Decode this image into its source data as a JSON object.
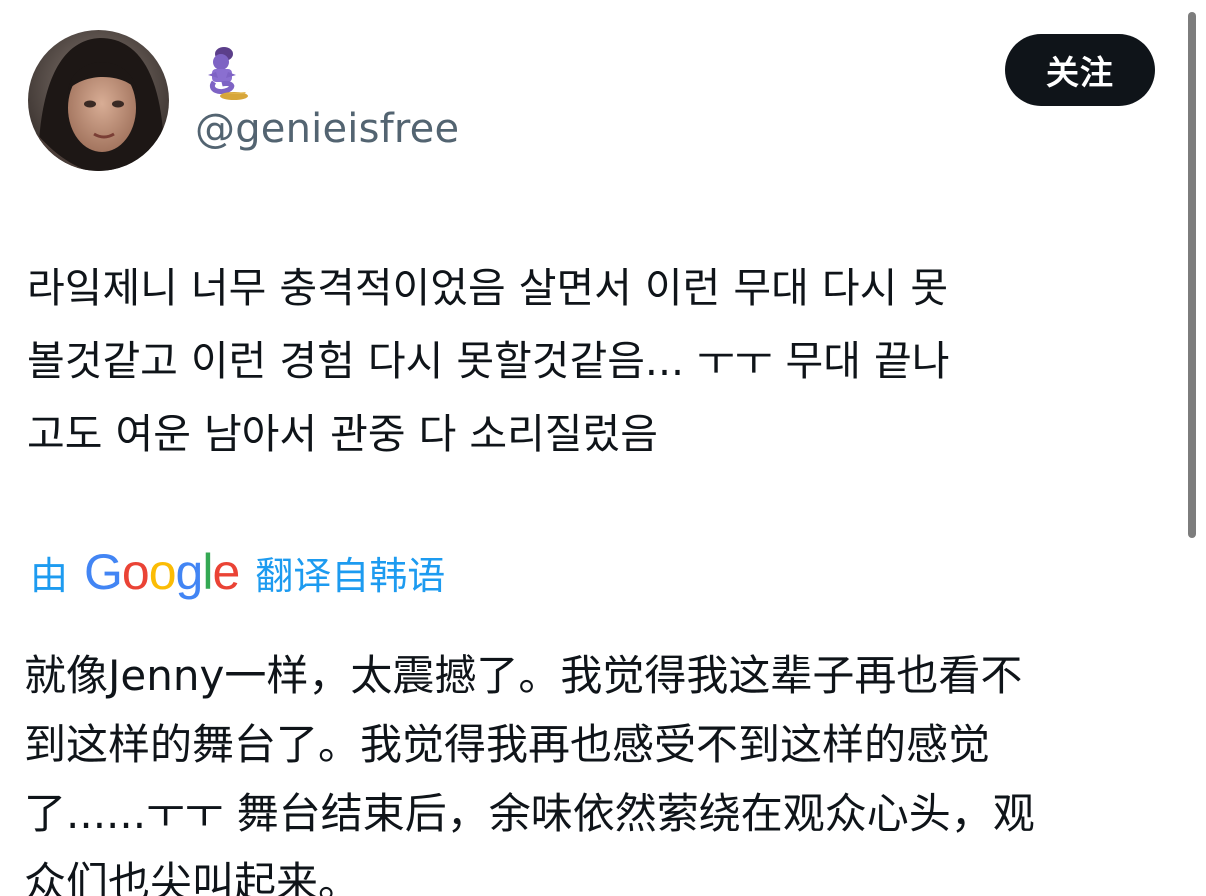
{
  "author": {
    "handle": "@genieisfree",
    "badge_icon": "genie-icon"
  },
  "follow_button": {
    "label": "关注"
  },
  "tweet": {
    "lines": [
      "라잌제니 너무 충격적이었음 살면서 이런 무대 다시 못",
      "볼것같고 이런 경험 다시 못할것같음... ㅜㅜ 무대 끝나",
      "고도 여운 남아서 관중 다 소리질렀음"
    ]
  },
  "translation": {
    "prefix": "由",
    "provider_letters": [
      "G",
      "o",
      "o",
      "g",
      "l",
      "e"
    ],
    "provider_colors": [
      "#4285F4",
      "#EA4335",
      "#FBBC05",
      "#4285F4",
      "#34A853",
      "#EA4335"
    ],
    "suffix": "翻译自韩语",
    "lines": [
      "就像Jenny一样，太震撼了。我觉得我这辈子再也看不",
      "到这样的舞台了。我觉得我再也感受不到这样的感觉",
      "了......ㅜㅜ 舞台结束后，余味依然萦绕在观众心头，观",
      "众们也尖叫起来。"
    ]
  },
  "colors": {
    "link": "#1d9bf0",
    "handle": "#536471",
    "text": "#0f1419",
    "button_bg": "#0f1419"
  }
}
